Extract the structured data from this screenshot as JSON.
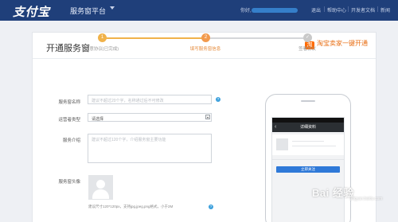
{
  "header": {
    "logo": "支付宝",
    "platform": "服务窗平台",
    "account_label": "你好,",
    "nav": [
      "退出",
      "帮助中心",
      "开发者文档",
      "新闻"
    ],
    "background": "#1f3f7a"
  },
  "panel": {
    "title": "开通服务窗",
    "taobao_link": "淘宝卖家一键开通",
    "taobao_icon": "淘"
  },
  "steps": [
    {
      "number": "1",
      "label": "同意协议(已完成)",
      "state": "done",
      "color": "#f0b24a"
    },
    {
      "number": "2",
      "label": "填写服务窗信息",
      "state": "current",
      "color": "#f29a4d"
    },
    {
      "number": "✓",
      "label": "签署协议",
      "state": "todo",
      "color": "#c9c9c9"
    }
  ],
  "form": {
    "name_label": "服务窗名称",
    "name_placeholder": "建议不超过20个字，名称通过后不可修改",
    "type_label": "运营者类型",
    "type_value": "请选择",
    "intro_label": "服务介绍",
    "intro_placeholder": "建议不超过120个字，介绍服务窗主要功能",
    "avatar_label": "服务窗头像",
    "avatar_hint": "建议尺寸120*120px，支持jpg,jpeg,png格式，小于2M",
    "help_glyph": "?"
  },
  "phone": {
    "header_title": "详细资料",
    "back_glyph": "‹",
    "button_label": "立即关注"
  },
  "watermark": {
    "brand": "Bai 经验",
    "sub": "jingyan.baidu.com"
  }
}
